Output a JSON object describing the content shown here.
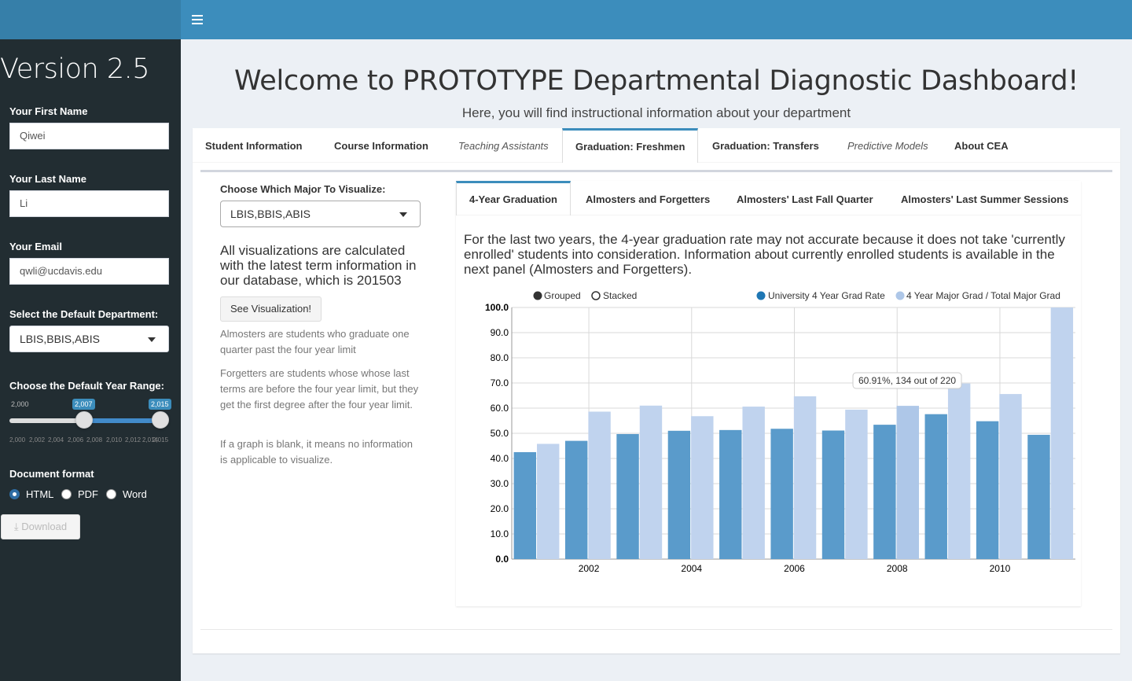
{
  "sidebar": {
    "version": "Version 2.5",
    "first_name_label": "Your First Name",
    "first_name_value": "Qiwei",
    "last_name_label": "Your Last Name",
    "last_name_value": "Li",
    "email_label": "Your Email",
    "email_value": "qwli@ucdavis.edu",
    "department_label": "Select the Default Department:",
    "department_value": "LBIS,BBIS,ABIS",
    "year_range_label": "Choose the Default Year Range:",
    "slider": {
      "min_label": "2,000",
      "max_label": "2,015",
      "from_label": "2,007",
      "to_label": "2,015",
      "ticks": [
        "2,000",
        "2,002",
        "2,004",
        "2,006",
        "2,008",
        "2,010",
        "2,012",
        "2,014",
        "2,015"
      ]
    },
    "doc_format_label": "Document format",
    "formats": [
      "HTML",
      "PDF",
      "Word"
    ],
    "selected_format": "HTML",
    "download_label": "Download"
  },
  "header": {
    "title": "Welcome to PROTOTYPE Departmental Diagnostic Dashboard!",
    "subtitle": "Here, you will find instructional information about your department"
  },
  "tabs": [
    "Student Information",
    "Course Information",
    "Teaching Assistants",
    "Graduation: Freshmen",
    "Graduation: Transfers",
    "Predictive Models",
    "About CEA"
  ],
  "active_tab": "Graduation: Freshmen",
  "left_panel": {
    "major_label": "Choose Which Major To Visualize:",
    "major_value": "LBIS,BBIS,ABIS",
    "info": "All visualizations are calculated with the latest term information in our database, which is 201503",
    "button": "See Visualization!",
    "help1": "Almosters are students who graduate one quarter past the four year limit",
    "help2": "Forgetters are students whose whose last terms are before the four year limit, but they get the first degree after the four year limit.",
    "help3": "If a graph is blank, it means no information is applicable to visualize."
  },
  "inner_tabs": [
    "4-Year Graduation",
    "Almosters and Forgetters",
    "Almosters' Last Fall Quarter",
    "Almosters' Last Summer Sessions"
  ],
  "active_inner_tab": "4-Year Graduation",
  "note": "For the last two years, the 4-year graduation rate may not accurate because it does not take 'currently enrolled' students into consideration. Information about currently enrolled students is available in the next panel (Almosters and Forgetters).",
  "chart_controls": {
    "grouped": "Grouped",
    "stacked": "Stacked",
    "selected": "Grouped"
  },
  "tooltip": "60.91%, 134 out of 220",
  "colors": {
    "series1": "#5a9bcb",
    "series2": "#c0d3ee",
    "highlight": "#aec7e8",
    "accent": "#3c8dbc"
  },
  "chart_data": {
    "type": "bar",
    "x": [
      2001,
      2002,
      2003,
      2004,
      2005,
      2006,
      2007,
      2008,
      2009,
      2010,
      2011
    ],
    "x_tick_labels": [
      "2002",
      "2004",
      "2006",
      "2008",
      "2010"
    ],
    "series": [
      {
        "name": "University 4 Year Grad Rate",
        "values": [
          42.5,
          47.0,
          49.7,
          51.0,
          51.3,
          51.8,
          51.1,
          53.4,
          57.6,
          54.8,
          49.4
        ]
      },
      {
        "name": "4 Year Major Grad / Total Major Grad",
        "values": [
          45.8,
          58.6,
          61.0,
          56.8,
          60.6,
          64.7,
          59.4,
          60.91,
          69.8,
          65.6,
          100.0
        ]
      }
    ],
    "ylim": [
      0,
      100
    ],
    "y_tick_labels": [
      "0.0",
      "10.0",
      "20.0",
      "30.0",
      "40.0",
      "50.0",
      "60.0",
      "70.0",
      "80.0",
      "90.0",
      "100.0"
    ],
    "grid": true,
    "legend_position": "top-right"
  }
}
